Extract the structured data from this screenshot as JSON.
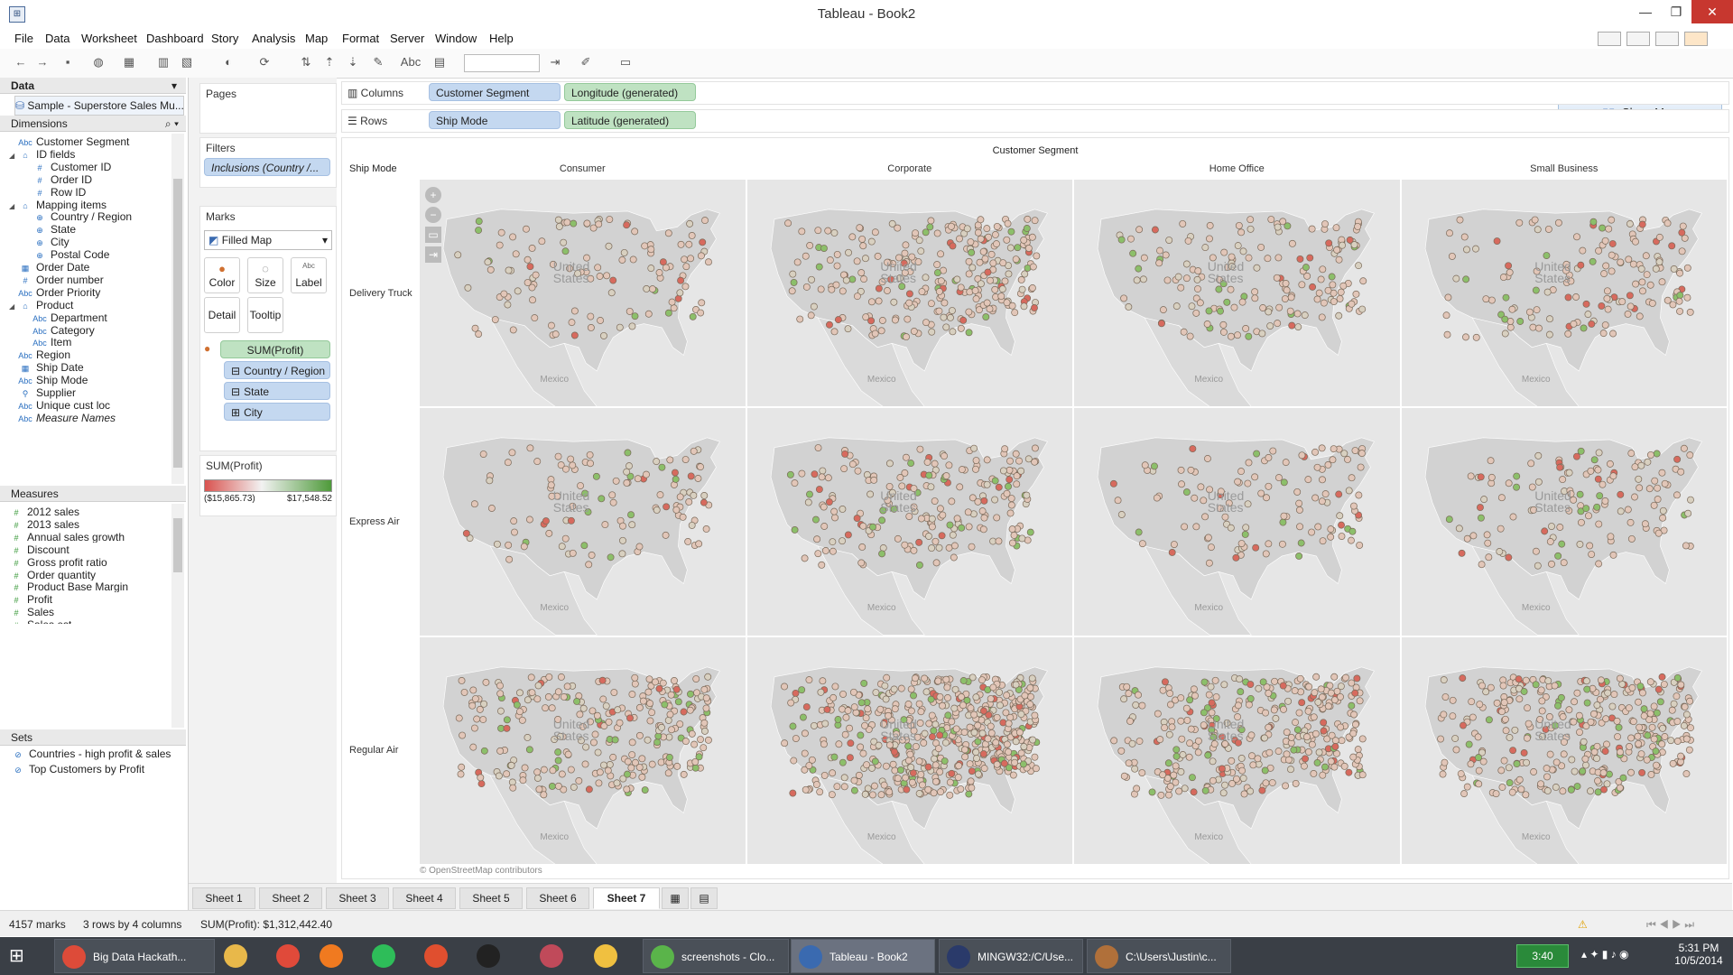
{
  "window": {
    "title": "Tableau - Book2"
  },
  "menu": [
    "File",
    "Data",
    "Worksheet",
    "Dashboard",
    "Story",
    "Analysis",
    "Map",
    "Format",
    "Server",
    "Window",
    "Help"
  ],
  "toolbar": {
    "show_me": "Show Me",
    "abc_label": "Abc"
  },
  "data_pane": {
    "header": "Data",
    "datasource": "Sample - Superstore Sales Mu...",
    "dimensions_header": "Dimensions",
    "dimensions": [
      {
        "icon": "Abc",
        "label": "Customer Segment",
        "indent": 0,
        "expander": ""
      },
      {
        "icon": "folder",
        "label": "ID fields",
        "indent": 0,
        "expander": "◢"
      },
      {
        "icon": "#",
        "label": "Customer ID",
        "indent": 1,
        "expander": ""
      },
      {
        "icon": "#",
        "label": "Order ID",
        "indent": 1,
        "expander": ""
      },
      {
        "icon": "#",
        "label": "Row ID",
        "indent": 1,
        "expander": ""
      },
      {
        "icon": "folder",
        "label": "Mapping items",
        "indent": 0,
        "expander": "◢"
      },
      {
        "icon": "globe",
        "label": "Country / Region",
        "indent": 1,
        "expander": ""
      },
      {
        "icon": "globe",
        "label": "State",
        "indent": 1,
        "expander": ""
      },
      {
        "icon": "globe",
        "label": "City",
        "indent": 1,
        "expander": ""
      },
      {
        "icon": "globe",
        "label": "Postal Code",
        "indent": 1,
        "expander": ""
      },
      {
        "icon": "date",
        "label": "Order Date",
        "indent": 0,
        "expander": ""
      },
      {
        "icon": "#",
        "label": "Order number",
        "indent": 0,
        "expander": ""
      },
      {
        "icon": "Abc",
        "label": "Order Priority",
        "indent": 0,
        "expander": ""
      },
      {
        "icon": "folder",
        "label": "Product",
        "indent": 0,
        "expander": "◢"
      },
      {
        "icon": "Abc",
        "label": "Department",
        "indent": 1,
        "expander": ""
      },
      {
        "icon": "Abc",
        "label": "Category",
        "indent": 1,
        "expander": ""
      },
      {
        "icon": "Abc",
        "label": "Item",
        "indent": 1,
        "expander": ""
      },
      {
        "icon": "Abc",
        "label": "Region",
        "indent": 0,
        "expander": ""
      },
      {
        "icon": "date",
        "label": "Ship Date",
        "indent": 0,
        "expander": ""
      },
      {
        "icon": "Abc",
        "label": "Ship Mode",
        "indent": 0,
        "expander": ""
      },
      {
        "icon": "link",
        "label": "Supplier",
        "indent": 0,
        "expander": ""
      },
      {
        "icon": "Abc",
        "label": "Unique cust loc",
        "indent": 0,
        "expander": ""
      },
      {
        "icon": "Abc",
        "label": "Measure Names",
        "indent": 0,
        "expander": "",
        "italic": true
      }
    ],
    "measures_header": "Measures",
    "measures": [
      "2012 sales",
      "2013 sales",
      "Annual sales growth",
      "Discount",
      "Gross profit ratio",
      "Order quantity",
      "Product Base Margin",
      "Profit",
      "Sales",
      "Sales est"
    ],
    "sets_header": "Sets",
    "sets": [
      "Countries - high profit & sales",
      "Top Customers by Profit"
    ]
  },
  "cards": {
    "pages_title": "Pages",
    "filters_title": "Filters",
    "filter_pill": "Inclusions (Country /...",
    "marks_title": "Marks",
    "mark_type": "Filled Map",
    "mark_buttons": [
      "Color",
      "Size",
      "Label",
      "Detail",
      "Tooltip"
    ],
    "mark_pills": [
      {
        "label": "SUM(Profit)",
        "type": "green",
        "icon": "color-icon"
      },
      {
        "label": "Country / Region",
        "type": "blue",
        "icon": "⊟"
      },
      {
        "label": "State",
        "type": "blue",
        "icon": "⊟"
      },
      {
        "label": "City",
        "type": "blue",
        "icon": "⊞"
      }
    ],
    "legend_title": "SUM(Profit)",
    "legend_min": "($15,865.73)",
    "legend_max": "$17,548.52",
    "legend_colors": {
      "low": "#d9534f",
      "mid": "#f2f2f2",
      "high": "#4e9a3a"
    }
  },
  "shelves": {
    "columns_label": "Columns",
    "rows_label": "Rows",
    "columns": [
      {
        "label": "Customer Segment",
        "type": "blue"
      },
      {
        "label": "Longitude (generated)",
        "type": "green"
      }
    ],
    "rows": [
      {
        "label": "Ship Mode",
        "type": "blue"
      },
      {
        "label": "Latitude (generated)",
        "type": "green"
      }
    ]
  },
  "viz": {
    "column_title": "Customer Segment",
    "row_title": "Ship Mode",
    "columns": [
      "Consumer",
      "Corporate",
      "Home Office",
      "Small Business"
    ],
    "rows": [
      "Delivery Truck",
      "Express Air",
      "Regular Air"
    ],
    "map_label_country": "United States",
    "map_label_mexico": "Mexico",
    "attribution": "© OpenStreetMap contributors",
    "colors": {
      "map_bg": "#e6e6e6",
      "land": "#d8d8d8",
      "mark_neutral": "#e2c6b8",
      "mark_red": "#d76a5e",
      "mark_green": "#8cbf6a"
    }
  },
  "sheet_tabs": [
    "Sheet 1",
    "Sheet 2",
    "Sheet 3",
    "Sheet 4",
    "Sheet 5",
    "Sheet 6",
    "Sheet 7"
  ],
  "active_tab": "Sheet 7",
  "status": {
    "marks": "4157 marks",
    "dims": "3 rows by 4 columns",
    "sum": "SUM(Profit): $1,312,442.40"
  },
  "taskbar": {
    "items": [
      {
        "label": "Big Data Hackath...",
        "color": "#dd4b39"
      },
      {
        "label": "",
        "color": "#e8b84a"
      },
      {
        "label": "",
        "color": "#e04a3a"
      },
      {
        "label": "",
        "color": "#f07a20"
      },
      {
        "label": "",
        "color": "#2ebd59"
      },
      {
        "label": "",
        "color": "#e04f2f"
      },
      {
        "label": "",
        "color": "#222"
      },
      {
        "label": "",
        "color": "#c04a5a"
      },
      {
        "label": "",
        "color": "#f0c040"
      },
      {
        "label": "screenshots - Clo...",
        "color": "#5ab44a"
      },
      {
        "label": "Tableau - Book2",
        "color": "#3a6ab0",
        "active": true
      },
      {
        "label": "MINGW32:/C/Use...",
        "color": "#2a3a6a"
      },
      {
        "label": "C:\\Users\\Justin\\c...",
        "color": "#b0703a"
      }
    ],
    "clock_badge": "3:40",
    "time": "5:31 PM",
    "date": "10/5/2014"
  }
}
